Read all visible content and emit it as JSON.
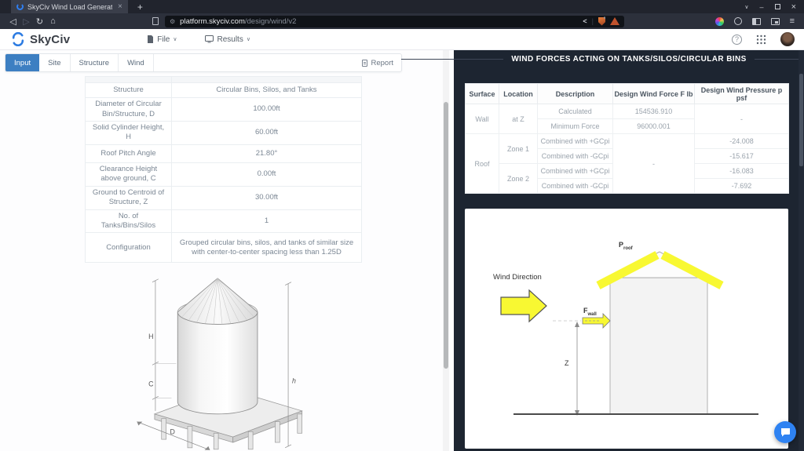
{
  "browser": {
    "tab_title": "SkyCiv Wind Load Generat",
    "url_domain": "platform.skyciv.com",
    "url_path": "/design/wind/v2"
  },
  "icons": {
    "back": "◁",
    "forward": "▷",
    "reload": "↻",
    "home": "⌂",
    "new_tab": "+",
    "tab_close": "×",
    "window_chevron": "∨",
    "window_minimize": "–",
    "window_close": "×",
    "menu": "≡",
    "share": "<",
    "pipe": "|",
    "caret_down": "∨",
    "help": "?",
    "tune": "⚙"
  },
  "header": {
    "brand": "SkyCiv",
    "file_menu": "File",
    "results_menu": "Results"
  },
  "left_panel": {
    "tabs": [
      {
        "label": "Input"
      },
      {
        "label": "Site"
      },
      {
        "label": "Structure"
      },
      {
        "label": "Wind"
      }
    ],
    "report_label": "Report",
    "structure_table": {
      "rows": [
        {
          "label": "Structure",
          "value": "Circular Bins, Silos, and Tanks"
        },
        {
          "label": "Diameter of Circular Bin/Structure, D",
          "value": "100.00ft"
        },
        {
          "label": "Solid Cylinder Height, H",
          "value": "60.00ft"
        },
        {
          "label": "Roof Pitch Angle",
          "value": "21.80°"
        },
        {
          "label": "Clearance Height above ground, C",
          "value": "0.00ft"
        },
        {
          "label": "Ground to Centroid of Structure, Z",
          "value": "30.00ft"
        },
        {
          "label": "No. of Tanks/Bins/Silos",
          "value": "1"
        },
        {
          "label": "Configuration",
          "value": "Grouped circular bins, silos, and tanks of similar size with center-to-center spacing less than 1.25D"
        }
      ]
    },
    "silo_diagram": {
      "H": "H",
      "C": "C",
      "h": "h",
      "D": "D"
    }
  },
  "right_panel": {
    "title": "WIND FORCES ACTING ON TANKS/SILOS/CIRCULAR BINS",
    "results_table": {
      "headers": [
        "Surface",
        "Location",
        "Description",
        "Design Wind Force F lb",
        "Design Wind Pressure p psf"
      ],
      "wall": {
        "surface": "Wall",
        "location": "at Z",
        "rows": [
          {
            "desc": "Calculated",
            "force": "154536.910"
          },
          {
            "desc": "Minimum Force",
            "force": "96000.001"
          }
        ],
        "pressure": "-"
      },
      "roof": {
        "surface": "Roof",
        "force": "-",
        "zones": [
          {
            "location": "Zone 1",
            "rows": [
              {
                "desc": "Combined with +GCpi",
                "pressure": "-24.008"
              },
              {
                "desc": "Combined with -GCpi",
                "pressure": "-15.617"
              }
            ]
          },
          {
            "location": "Zone 2",
            "rows": [
              {
                "desc": "Combined with +GCpi",
                "pressure": "-16.083"
              },
              {
                "desc": "Combined with -GCpi",
                "pressure": "-7.692"
              }
            ]
          }
        ]
      }
    },
    "diagram": {
      "wind_direction": "Wind Direction",
      "p_label": "P",
      "p_sub": "roof",
      "f_label": "F",
      "f_sub": "wall",
      "z_label": "Z",
      "yellow": "#f8f832"
    }
  }
}
